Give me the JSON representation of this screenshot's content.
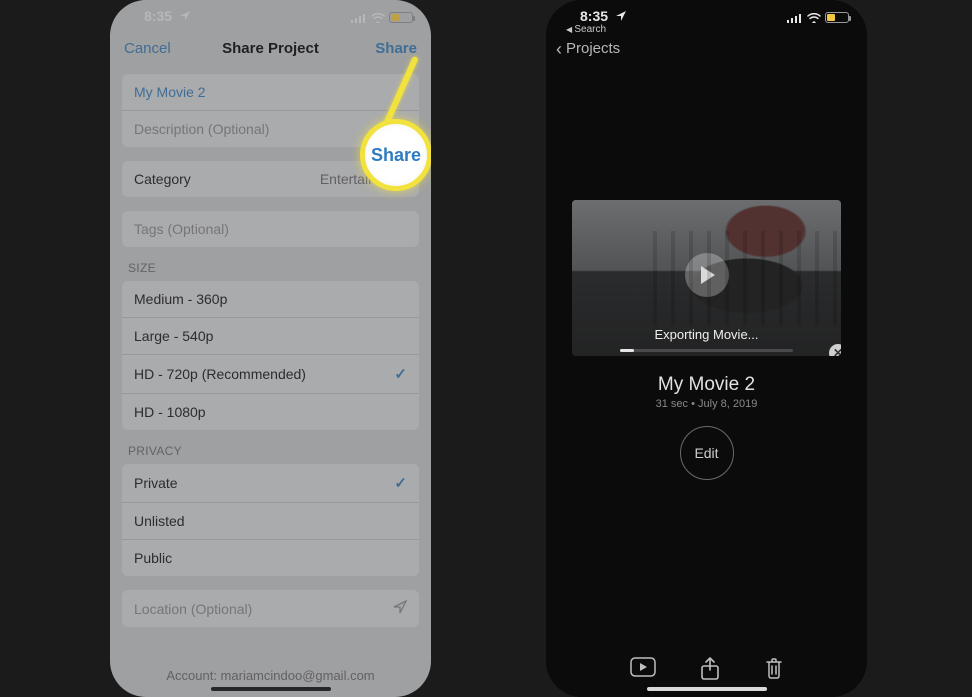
{
  "status": {
    "time": "8:35",
    "back_app": "Search",
    "battery_fill_pct": 38,
    "battery_fill_color": "#f4c742"
  },
  "left": {
    "nav": {
      "cancel": "Cancel",
      "title": "Share Project",
      "share": "Share"
    },
    "fields": {
      "title_value": "My Movie 2",
      "description_placeholder": "Description (Optional)",
      "category_label": "Category",
      "category_value": "Entertainment",
      "tags_placeholder": "Tags (Optional)",
      "location_placeholder": "Location (Optional)"
    },
    "size": {
      "header": "SIZE",
      "options": [
        "Medium - 360p",
        "Large - 540p",
        "HD - 720p (Recommended)",
        "HD - 1080p"
      ],
      "selected_index": 2
    },
    "privacy": {
      "header": "PRIVACY",
      "options": [
        "Private",
        "Unlisted",
        "Public"
      ],
      "selected_index": 0
    },
    "footer": "Account: mariamcindoo@gmail.com",
    "highlight_label": "Share"
  },
  "right": {
    "nav_back": "Projects",
    "thumb": {
      "status": "Exporting Movie...",
      "progress_pct": 8
    },
    "project": {
      "title": "My Movie 2",
      "meta": "31 sec • July 8, 2019",
      "edit": "Edit"
    },
    "toolbar": {
      "play": "play-icon",
      "share": "share-icon",
      "trash": "trash-icon"
    }
  }
}
